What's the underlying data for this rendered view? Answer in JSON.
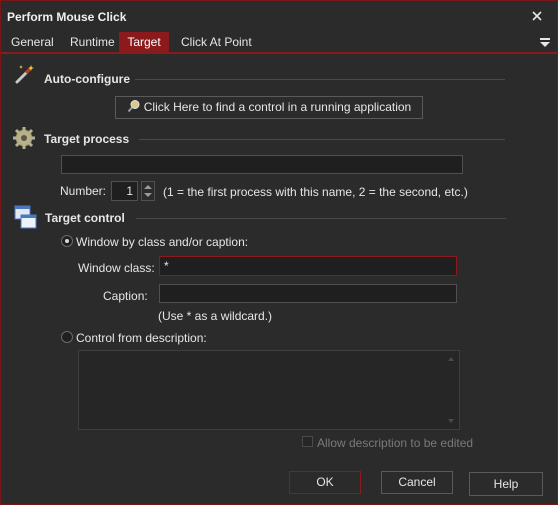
{
  "window": {
    "title": "Perform Mouse Click"
  },
  "tabs": [
    {
      "label": "General"
    },
    {
      "label": "Runtime"
    },
    {
      "label": "Target"
    },
    {
      "label": "Click At Point"
    }
  ],
  "auto_configure": {
    "title": "Auto-configure",
    "button_label": "Click Here to find a control in a running application"
  },
  "target_process": {
    "title": "Target process",
    "process_value": "",
    "number_label": "Number:",
    "number_value": "1",
    "number_hint": "(1 = the first process with this name, 2 = the second, etc.)"
  },
  "target_control": {
    "title": "Target control",
    "radio_class_label": "Window by class and/or caption:",
    "window_class_label": "Window class:",
    "window_class_value": "*",
    "caption_label": "Caption:",
    "caption_value": "",
    "wildcard_hint": "(Use * as a wildcard.)",
    "radio_description_label": "Control from description:",
    "allow_edit_label": "Allow description to be edited"
  },
  "footer": {
    "ok_label": "OK",
    "cancel_label": "Cancel",
    "help_label": "Help"
  },
  "colors": {
    "accent": "#8b1a1d",
    "background": "#2b2b2b",
    "text": "#e6e6e6"
  }
}
